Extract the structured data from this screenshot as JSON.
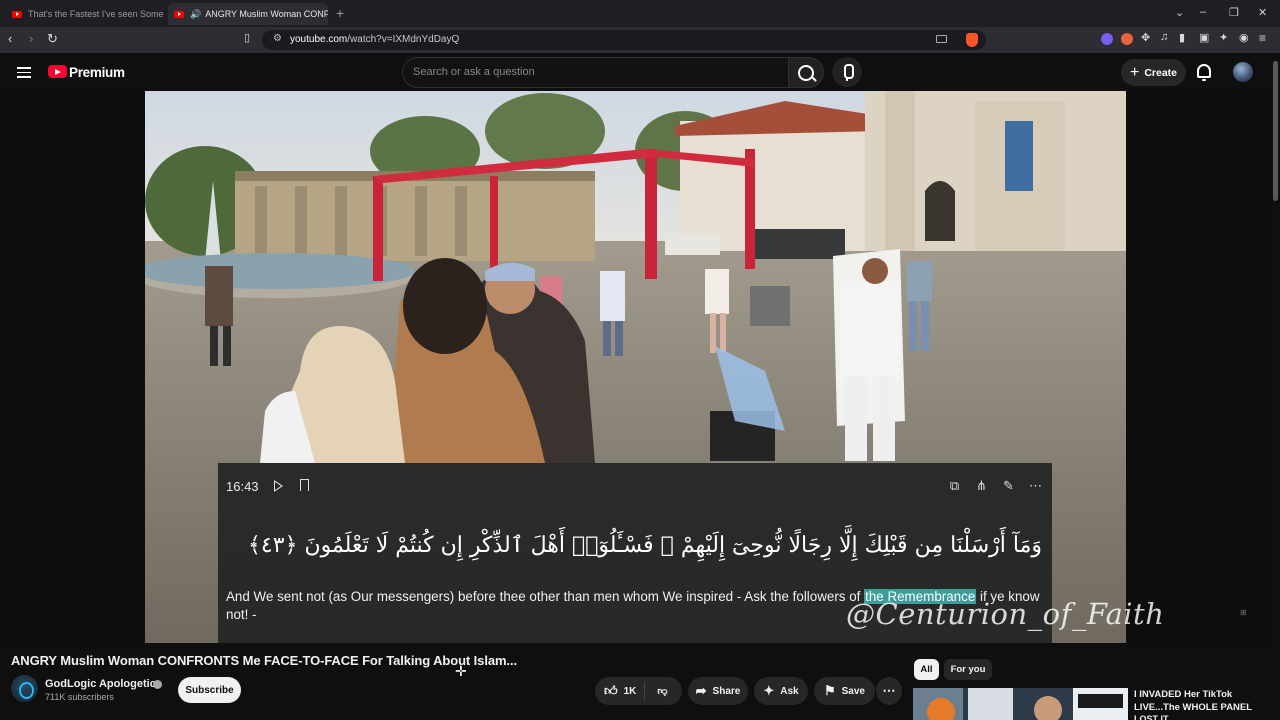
{
  "browser": {
    "tabs": [
      {
        "title": "That's the Fastest I've seen Someone",
        "active": false
      },
      {
        "title": "ANGRY Muslim Woman CONFRONTS",
        "active": true,
        "audio": true
      }
    ],
    "new_tab_symbol": "+",
    "url_domain": "youtube.com",
    "url_path": "/watch?v=IXMdnYdDayQ",
    "window_controls": {
      "minimize": "–",
      "maximize": "❐",
      "close": "✕",
      "tab_list": "⌄"
    }
  },
  "youtube": {
    "brand": "Premium",
    "search_placeholder": "Search or ask a question",
    "create_label": "Create",
    "accent_color": "#ff0033"
  },
  "overlay": {
    "timestamp": "16:43",
    "arabic_verse": "وَمَآ أَرْسَلْنَا مِن قَبْلِكَ إِلَّا رِجَالًا نُّوحِىٓ إِلَيْهِمْ ۖ فَسْـَٔلُوٓا۟ أَهْلَ ٱلذِّكْرِ إِن كُنتُمْ لَا تَعْلَمُونَ ﴿٤٣﴾",
    "translation_before": "And We sent not (as Our messengers) before thee other than men whom We inspired - Ask the followers of ",
    "translation_highlight": "the Remembrance",
    "translation_after": " if ye know not! -",
    "highlight_color": "#3c9e9a",
    "watermark": "@Centurion_of_Faith"
  },
  "video": {
    "title": "ANGRY Muslim Woman CONFRONTS Me FACE-TO-FACE For Talking About Islam...",
    "channel": "GodLogic Apologetics",
    "subscribers": "711K subscribers",
    "subscribe_label": "Subscribe",
    "like_count": "1K",
    "share_label": "Share",
    "ask_label": "Ask",
    "save_label": "Save"
  },
  "sidebar": {
    "chips": [
      "All",
      "For you"
    ],
    "selected_chip": "All",
    "recommended": [
      {
        "title": "I INVADED Her TikTok LIVE...The WHOLE PANEL",
        "title_line2": "LOST IT"
      }
    ]
  }
}
